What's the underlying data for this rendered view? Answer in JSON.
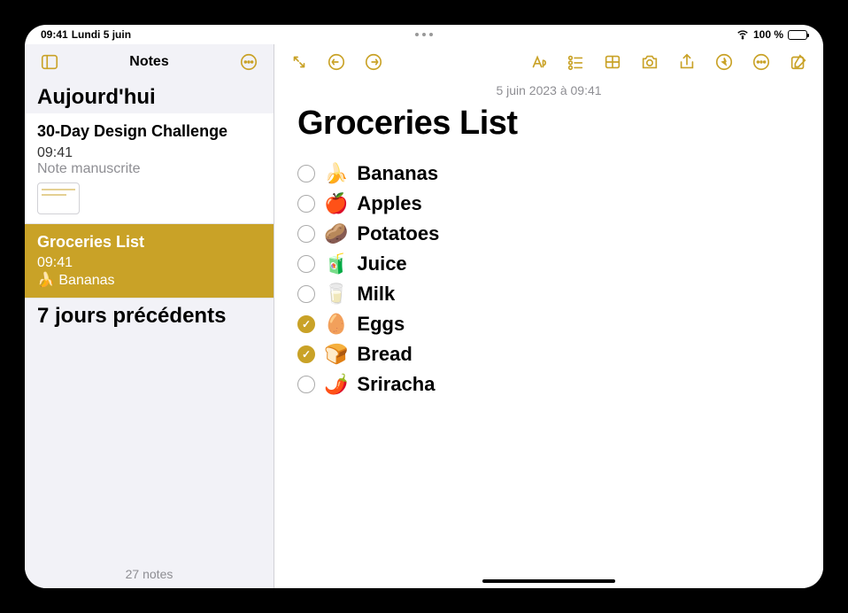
{
  "status": {
    "time": "09:41",
    "date": "Lundi 5 juin",
    "battery": "100 %"
  },
  "sidebar": {
    "title": "Notes",
    "sections": {
      "today": "Aujourd'hui",
      "previous": "7 jours précédents"
    },
    "items": [
      {
        "title": "30-Day Design Challenge",
        "time": "09:41",
        "preview": "Note manuscrite",
        "selected": false,
        "has_thumb": true
      },
      {
        "title": "Groceries List",
        "time": "09:41",
        "preview": "🍌 Bananas",
        "selected": true,
        "has_thumb": false
      }
    ],
    "footer": "27 notes"
  },
  "note": {
    "date": "5 juin 2023 à 09:41",
    "title": "Groceries List",
    "items": [
      {
        "emoji": "🍌",
        "text": "Bananas",
        "checked": false
      },
      {
        "emoji": "🍎",
        "text": "Apples",
        "checked": false
      },
      {
        "emoji": "🥔",
        "text": "Potatoes",
        "checked": false
      },
      {
        "emoji": "🧃",
        "text": "Juice",
        "checked": false
      },
      {
        "emoji": "🥛",
        "text": "Milk",
        "checked": false
      },
      {
        "emoji": "🥚",
        "text": "Eggs",
        "checked": true
      },
      {
        "emoji": "🍞",
        "text": "Bread",
        "checked": true
      },
      {
        "emoji": "🌶️",
        "text": "Sriracha",
        "checked": false
      }
    ]
  },
  "colors": {
    "accent": "#c9a227"
  }
}
